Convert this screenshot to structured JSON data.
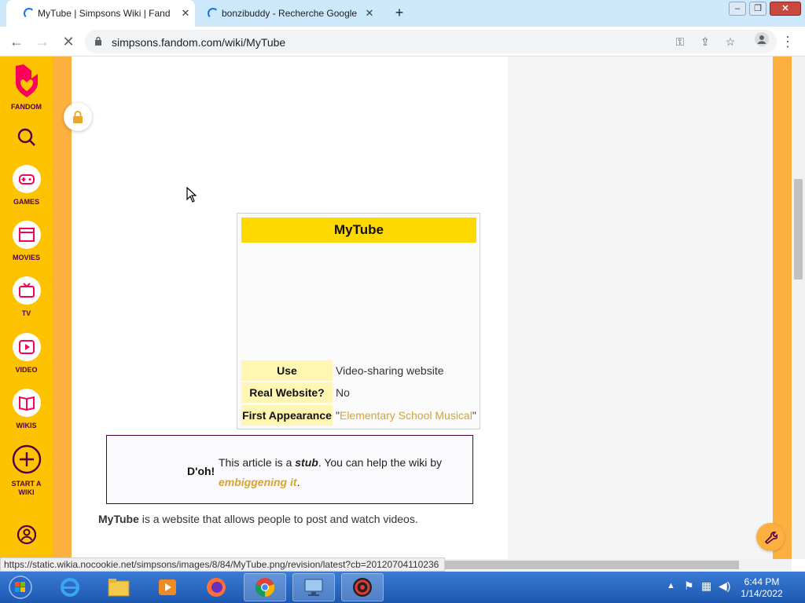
{
  "browser": {
    "tabs": [
      {
        "title": "MyTube | Simpsons Wiki | Fandom",
        "active": true
      },
      {
        "title": "bonzibuddy - Recherche Google",
        "active": false
      }
    ],
    "url": "simpsons.fandom.com/wiki/MyTube",
    "status_url": "https://static.wikia.nocookie.net/simpsons/images/8/84/MyTube.png/revision/latest?cb=20120704110236"
  },
  "fandom_rail": {
    "logo_label": "FANDOM",
    "items": [
      {
        "label": "GAMES",
        "icon": "gamepad-icon"
      },
      {
        "label": "MOVIES",
        "icon": "clapperboard-icon"
      },
      {
        "label": "TV",
        "icon": "tv-icon"
      },
      {
        "label": "VIDEO",
        "icon": "play-icon"
      },
      {
        "label": "WIKIS",
        "icon": "book-icon"
      },
      {
        "label": "START A",
        "label2": "WIKI",
        "icon": "plus-circle-icon"
      }
    ]
  },
  "infobox": {
    "title": "MyTube",
    "rows": [
      {
        "label": "Use",
        "value": "Video-sharing website"
      },
      {
        "label": "Real Website?",
        "value": "No"
      },
      {
        "label": "First Appearance",
        "value_prefix": "\"",
        "value_link": "Elementary School Musical",
        "value_suffix": "\""
      }
    ]
  },
  "stub": {
    "doh": "D'oh!",
    "text_before": "This article is a ",
    "bold": "stub",
    "text_mid": ". You can help the wiki by ",
    "link": "embiggening it",
    "text_after": "."
  },
  "intro": {
    "bold": "MyTube",
    "rest": " is a website that allows people to post and watch videos."
  },
  "taskbar": {
    "time": "6:44 PM",
    "date": "1/14/2022"
  },
  "colors": {
    "fandom_yellow": "#fdc300",
    "fandom_orange": "#fbb040",
    "infobox_title": "#fdd900",
    "link": "#d4a437"
  }
}
